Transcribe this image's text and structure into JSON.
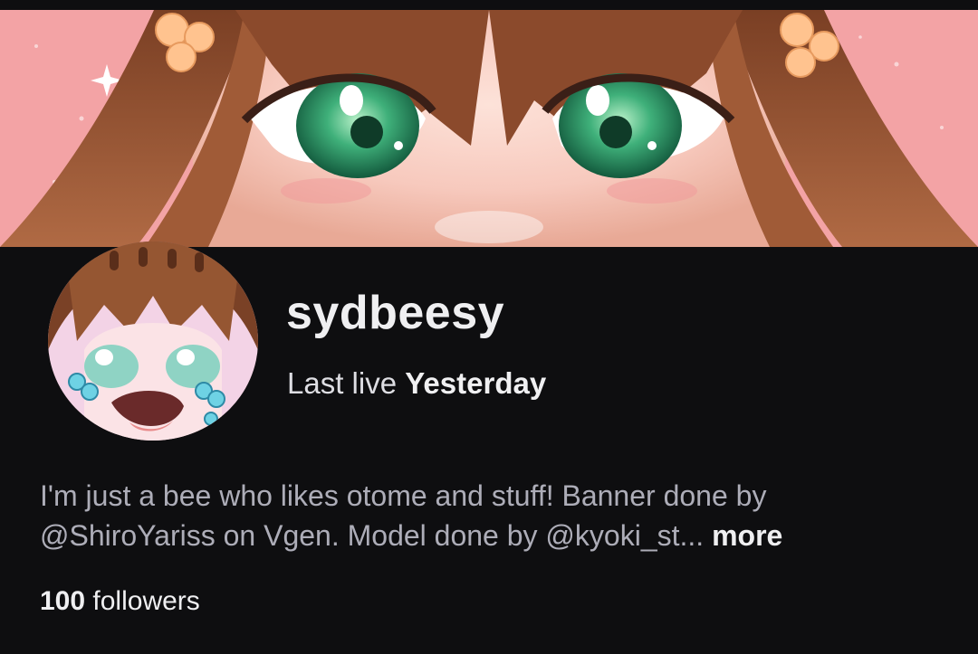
{
  "profile": {
    "username": "sydbeesy",
    "last_live_prefix": "Last live",
    "last_live_value": "Yesterday",
    "bio_line_1": "I'm just a bee who likes otome and stuff! Banner done by",
    "bio_line_2": "@ShiroYariss on Vgen. Model done by @kyoki_st...",
    "more_label": "more",
    "followers_count": "100",
    "followers_label": "followers"
  },
  "colors": {
    "background": "#0e0e10",
    "text_primary": "#efeff1",
    "text_secondary": "#adadb8",
    "banner_pink": "#f3a7a8",
    "eye_green": "#2f9a6a",
    "hair_brown": "#8b4f2e"
  },
  "images": {
    "banner": "anime-character-eyes-banner",
    "avatar": "crying-chibi-avatar"
  }
}
